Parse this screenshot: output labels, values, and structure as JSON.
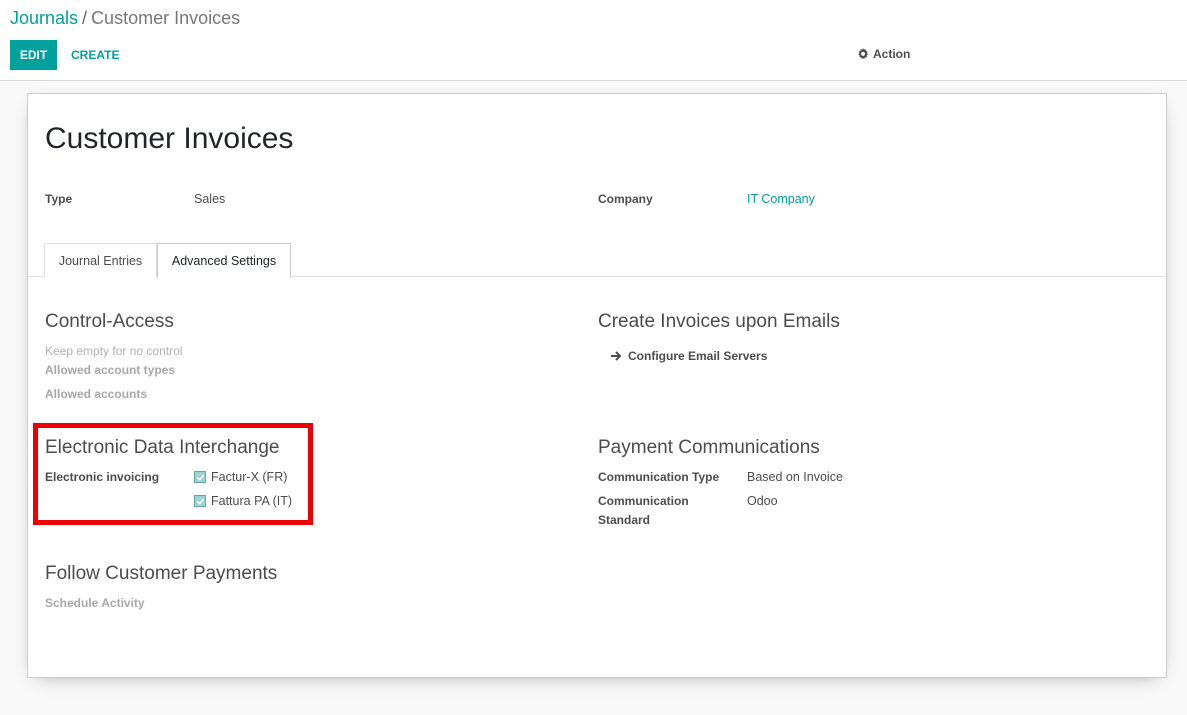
{
  "breadcrumb": {
    "parent": "Journals",
    "separator": "/",
    "current": "Customer Invoices"
  },
  "toolbar": {
    "edit_label": "EDIT",
    "create_label": "CREATE",
    "action_label": "Action",
    "action_icon": "gear-icon"
  },
  "record": {
    "title": "Customer Invoices",
    "type_label": "Type",
    "type_value": "Sales",
    "company_label": "Company",
    "company_value": "IT Company"
  },
  "tabs": [
    {
      "label": "Journal Entries",
      "active": false
    },
    {
      "label": "Advanced Settings",
      "active": true
    }
  ],
  "control_access": {
    "title": "Control-Access",
    "hint": "Keep empty for no control",
    "allowed_account_types": "Allowed account types",
    "allowed_accounts": "Allowed accounts"
  },
  "email_invoices": {
    "title": "Create Invoices upon Emails",
    "configure_label": "Configure Email Servers"
  },
  "edi": {
    "title": "Electronic Data Interchange",
    "label": "Electronic invoicing",
    "options": [
      {
        "label": "Factur-X (FR)",
        "checked": true
      },
      {
        "label": "Fattura PA (IT)",
        "checked": true
      }
    ]
  },
  "payment_communications": {
    "title": "Payment Communications",
    "type_label": "Communication Type",
    "type_value": "Based on Invoice",
    "standard_label_1": "Communication",
    "standard_label_2": "Standard",
    "standard_value": "Odoo"
  },
  "follow_payments": {
    "title": "Follow Customer Payments",
    "schedule_label": "Schedule Activity"
  },
  "colors": {
    "accent": "#00A09D",
    "highlight": "#ee0000"
  }
}
